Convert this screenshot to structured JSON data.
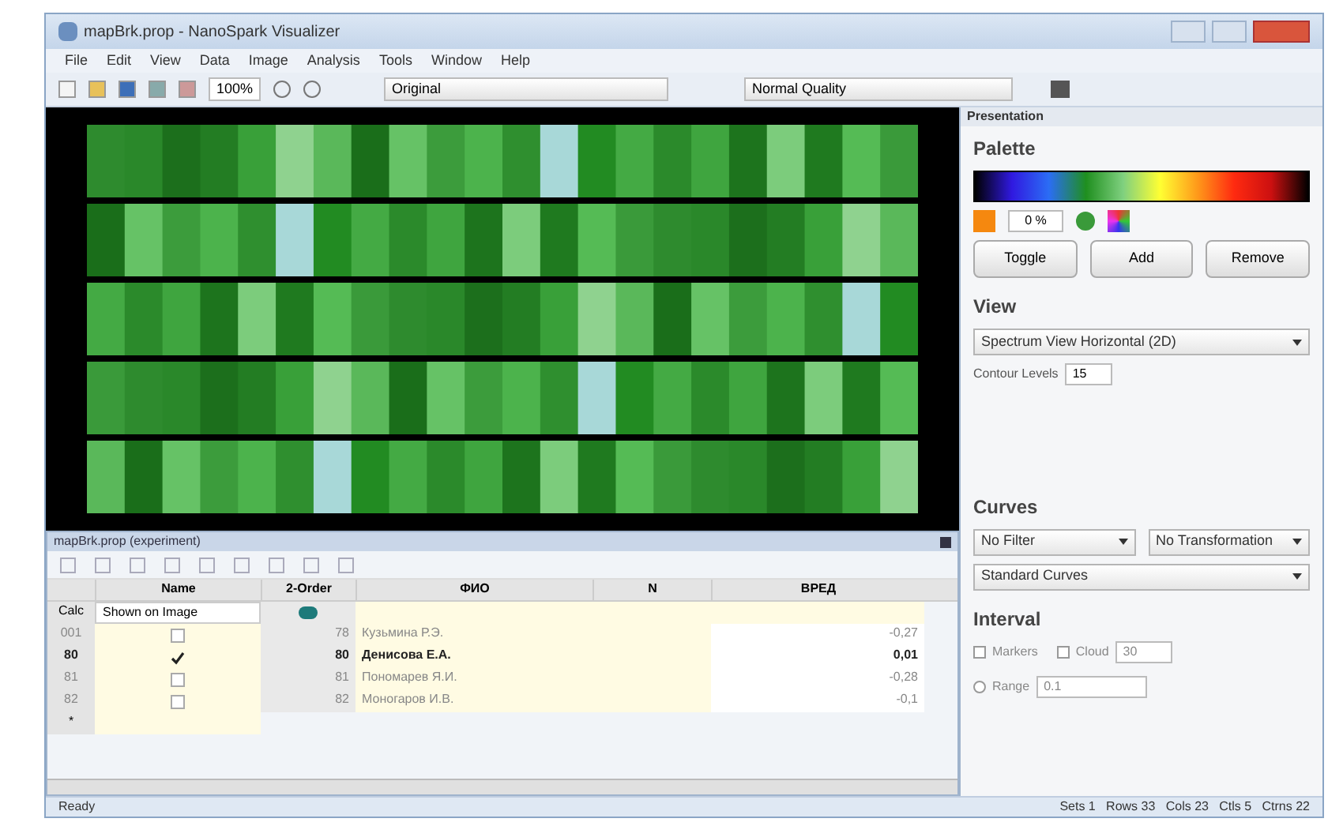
{
  "window": {
    "title": "mapBrk.prop - NanoSpark Visualizer"
  },
  "menu": [
    "File",
    "Edit",
    "View",
    "Data",
    "Image",
    "Analysis",
    "Tools",
    "Window",
    "Help"
  ],
  "toolbar": {
    "zoom": "100%",
    "image_mode": "Original",
    "quality": "Normal Quality"
  },
  "presentation": {
    "title": "Presentation",
    "palette_heading": "Palette",
    "palette_value": "0 %",
    "buttons": [
      "Toggle",
      "Add",
      "Remove"
    ],
    "view_heading": "View",
    "view_mode": "Spectrum View Horizontal (2D)",
    "contour_label": "Contour Levels",
    "contour_value": "15",
    "curves_heading": "Curves",
    "filter": "No Filter",
    "transformation": "No Transformation",
    "curves": "Standard Curves",
    "interval_heading": "Interval",
    "interval_options": [
      {
        "kind": "check",
        "label": "Markers",
        "checked": false
      },
      {
        "kind": "check",
        "label": "Cloud",
        "checked": false,
        "value": "30"
      },
      {
        "kind": "radio",
        "label": "Range",
        "checked": false,
        "value": "0.1"
      }
    ]
  },
  "table_panel": {
    "title": "mapBrk.prop (experiment)",
    "columns": [
      "Name",
      "2-Order",
      "ФИО",
      "N",
      "ВРЕД"
    ],
    "calc_row": {
      "label": "Calc",
      "name": "Shown on Image"
    },
    "rows": [
      {
        "label": "001",
        "checked": false,
        "number": "78",
        "name": "Кузьмина Р.Э.",
        "value": "-0,27",
        "selected": false
      },
      {
        "label": "80",
        "checked": true,
        "number": "80",
        "name": "Денисова Е.А.",
        "value": "0,01",
        "selected": true
      },
      {
        "label": "81",
        "checked": false,
        "number": "81",
        "name": "Пономарев Я.И.",
        "value": "-0,28",
        "selected": false
      },
      {
        "label": "82",
        "checked": false,
        "number": "82",
        "name": "Моногаров И.В.",
        "value": "-0,1",
        "selected": false
      }
    ],
    "new_row_label": "*"
  },
  "status_left": "Ready",
  "status_right": "Sets 1   Rows 33   Cols 23   Ctls 5   Ctrns 22"
}
